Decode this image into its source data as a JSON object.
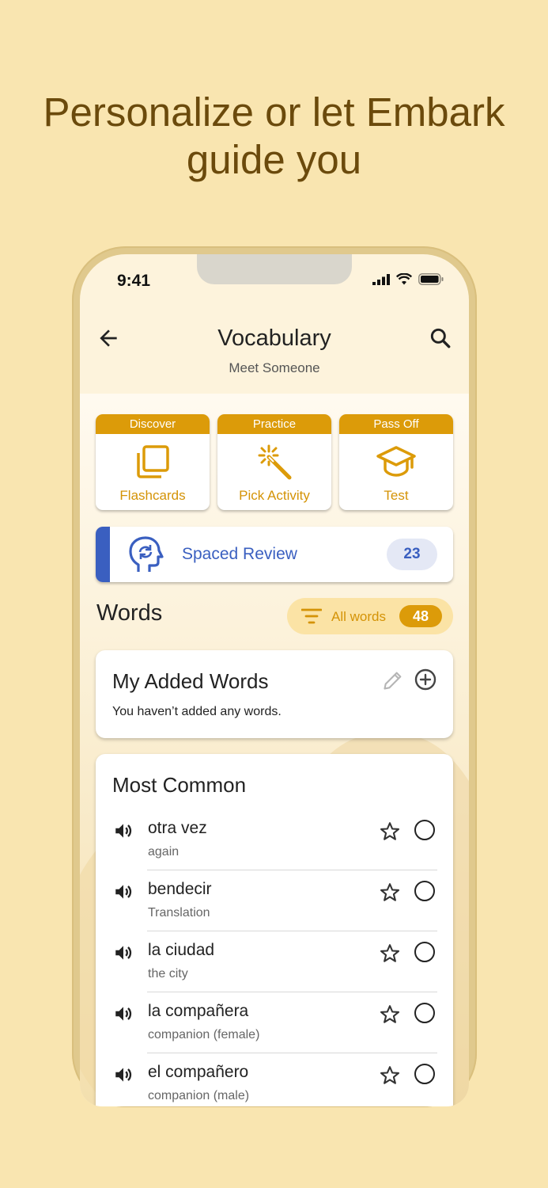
{
  "headline": {
    "line1": "Personalize or let Embark",
    "line2": "guide you"
  },
  "status": {
    "time": "9:41"
  },
  "topbar": {
    "title": "Vocabulary",
    "subtitle": "Meet Someone"
  },
  "activities": [
    {
      "header": "Discover",
      "label": "Flashcards"
    },
    {
      "header": "Practice",
      "label": "Pick Activity"
    },
    {
      "header": "Pass Off",
      "label": "Test"
    }
  ],
  "spaced_review": {
    "label": "Spaced Review",
    "count": "23"
  },
  "words_section": {
    "title": "Words",
    "filter_label": "All words",
    "filter_count": "48"
  },
  "added_words": {
    "title": "My Added Words",
    "empty_text": "You haven’t added any words."
  },
  "most_common": {
    "title": "Most Common",
    "words": [
      {
        "term": "otra vez",
        "translation": "again"
      },
      {
        "term": "bendecir",
        "translation": "Translation"
      },
      {
        "term": "la ciudad",
        "translation": "the city"
      },
      {
        "term": "la compañera",
        "translation": "companion (female)"
      },
      {
        "term": "el compañero",
        "translation": "companion (male)"
      }
    ]
  },
  "colors": {
    "accent": "#dc9b09",
    "review_blue": "#3a5fc0",
    "page_bg": "#f9e5b0",
    "headline": "#6b4a0c"
  }
}
